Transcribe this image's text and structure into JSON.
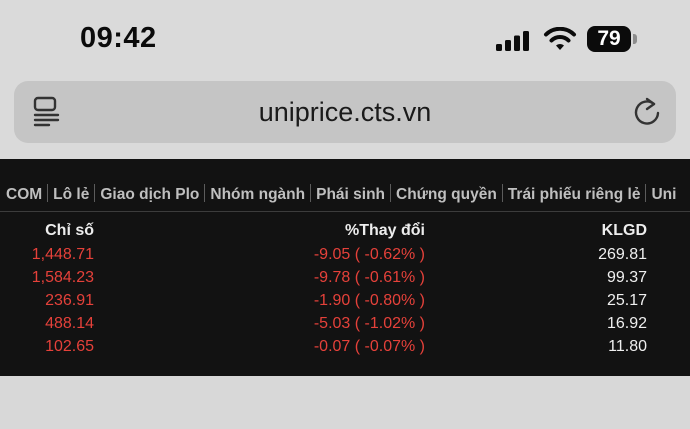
{
  "status_bar": {
    "time": "09:42",
    "battery": "79"
  },
  "browser": {
    "url": "uniprice.cts.vn"
  },
  "tabs": [
    "COM",
    "Lô lẻ",
    "Giao dịch Plo",
    "Nhóm ngành",
    "Phái sinh",
    "Chứng quyền",
    "Trái phiếu riêng lẻ",
    "Uni"
  ],
  "table": {
    "headers": {
      "index": "Chỉ số",
      "change": "%Thay đổi",
      "volume": "KLGD"
    },
    "rows": [
      {
        "index": "1,448.71",
        "change": "-9.05 ( -0.62% )",
        "volume": "269.81"
      },
      {
        "index": "1,584.23",
        "change": "-9.78 ( -0.61% )",
        "volume": "99.37"
      },
      {
        "index": "236.91",
        "change": "-1.90 ( -0.80% )",
        "volume": "25.17"
      },
      {
        "index": "488.14",
        "change": "-5.03 ( -1.02% )",
        "volume": "16.92"
      },
      {
        "index": "102.65",
        "change": "-0.07 ( -0.07% )",
        "volume": "11.80"
      }
    ]
  },
  "colors": {
    "negative": "#e5413a",
    "panel_bg": "#121212"
  }
}
